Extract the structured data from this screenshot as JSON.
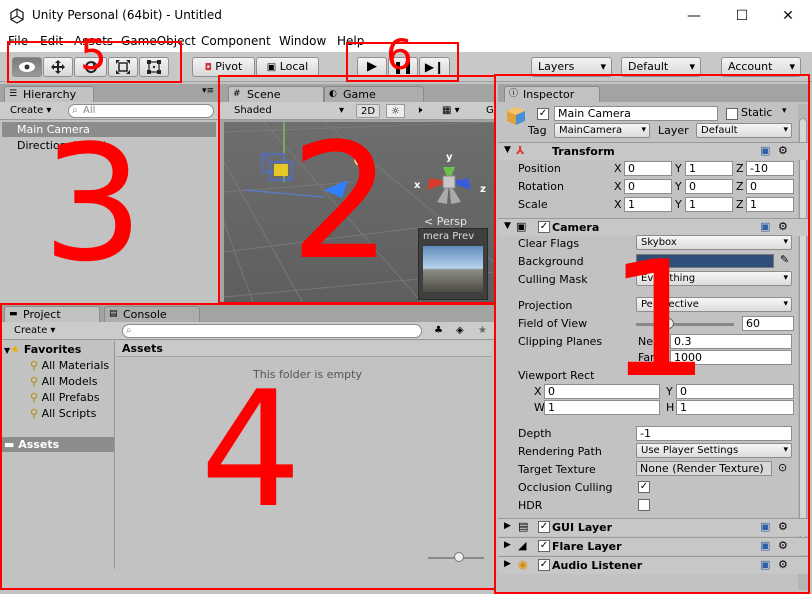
{
  "window": {
    "title": "Unity Personal (64bit) - Untitled",
    "minimize": "—",
    "maximize": "☐",
    "close": "✕"
  },
  "menu": [
    "File",
    "Edit",
    "Assets",
    "GameObject",
    "Component",
    "Window",
    "Help"
  ],
  "toolbar": {
    "pivot_label": "Pivot",
    "local_label": "Local",
    "layers_label": "Layers",
    "layout_label": "Default",
    "account_label": "Account"
  },
  "hierarchy": {
    "tab_label": "Hierarchy",
    "create_label": "Create",
    "search_placeholder": "All",
    "items": [
      "Main Camera",
      "Directional Light"
    ]
  },
  "scene": {
    "tab_scene": "Scene",
    "tab_game": "Game",
    "shading_mode": "Shaded",
    "mode_2d": "2D",
    "gizmos_label": "G",
    "persp_label": "< Persp",
    "camera_preview_label": "mera Prev",
    "axis_x": "x",
    "axis_y": "y",
    "axis_z": "z"
  },
  "project": {
    "tab_project": "Project",
    "tab_console": "Console",
    "create_label": "Create",
    "favorites_label": "Favorites",
    "favorites": [
      "All Materials",
      "All Models",
      "All Prefabs",
      "All Scripts"
    ],
    "assets_label": "Assets",
    "header": "Assets",
    "empty_text": "This folder is empty",
    "zoom_level": 0.6
  },
  "inspector": {
    "tab_label": "Inspector",
    "object_name": "Main Camera",
    "static_label": "Static",
    "tag_label": "Tag",
    "tag_value": "MainCamera",
    "layer_label": "Layer",
    "layer_value": "Default",
    "transform": {
      "title": "Transform",
      "position_label": "Position",
      "rotation_label": "Rotation",
      "scale_label": "Scale",
      "position": [
        "0",
        "1",
        "-10"
      ],
      "rotation": [
        "0",
        "0",
        "0"
      ],
      "scale": [
        "1",
        "1",
        "1"
      ],
      "x": "X",
      "y": "Y",
      "z": "Z"
    },
    "camera": {
      "title": "Camera",
      "clear_flags_label": "Clear Flags",
      "clear_flags_value": "Skybox",
      "background_label": "Background",
      "background_color": "#2e4f7a",
      "culling_mask_label": "Culling Mask",
      "culling_mask_value": "Everything",
      "projection_label": "Projection",
      "projection_value": "Perspective",
      "fov_label": "Field of View",
      "fov_value": "60",
      "fov_fraction": 0.33,
      "clipping_label": "Clipping Planes",
      "near_label": "Near",
      "near_value": "0.3",
      "far_label": "Far",
      "far_value": "1000",
      "viewport_label": "Viewport Rect",
      "vx_label": "X",
      "vx": "0",
      "vy_label": "Y",
      "vy": "0",
      "vw_label": "W",
      "vw": "1",
      "vh_label": "H",
      "vh": "1",
      "depth_label": "Depth",
      "depth_value": "-1",
      "rendering_path_label": "Rendering Path",
      "rendering_path_value": "Use Player Settings",
      "target_texture_label": "Target Texture",
      "target_texture_value": "None (Render Texture)",
      "occlusion_label": "Occlusion Culling",
      "occlusion_checked": true,
      "hdr_label": "HDR",
      "hdr_checked": false
    },
    "components": [
      "GUI Layer",
      "Flare Layer",
      "Audio Listener"
    ]
  },
  "annotations": {
    "n1": "1",
    "n2": "2",
    "n3": "3",
    "n4": "4",
    "n5": "5",
    "n6": "6"
  },
  "colors": {
    "annotation": "#ff0000",
    "selection": "#8c8c8c"
  }
}
